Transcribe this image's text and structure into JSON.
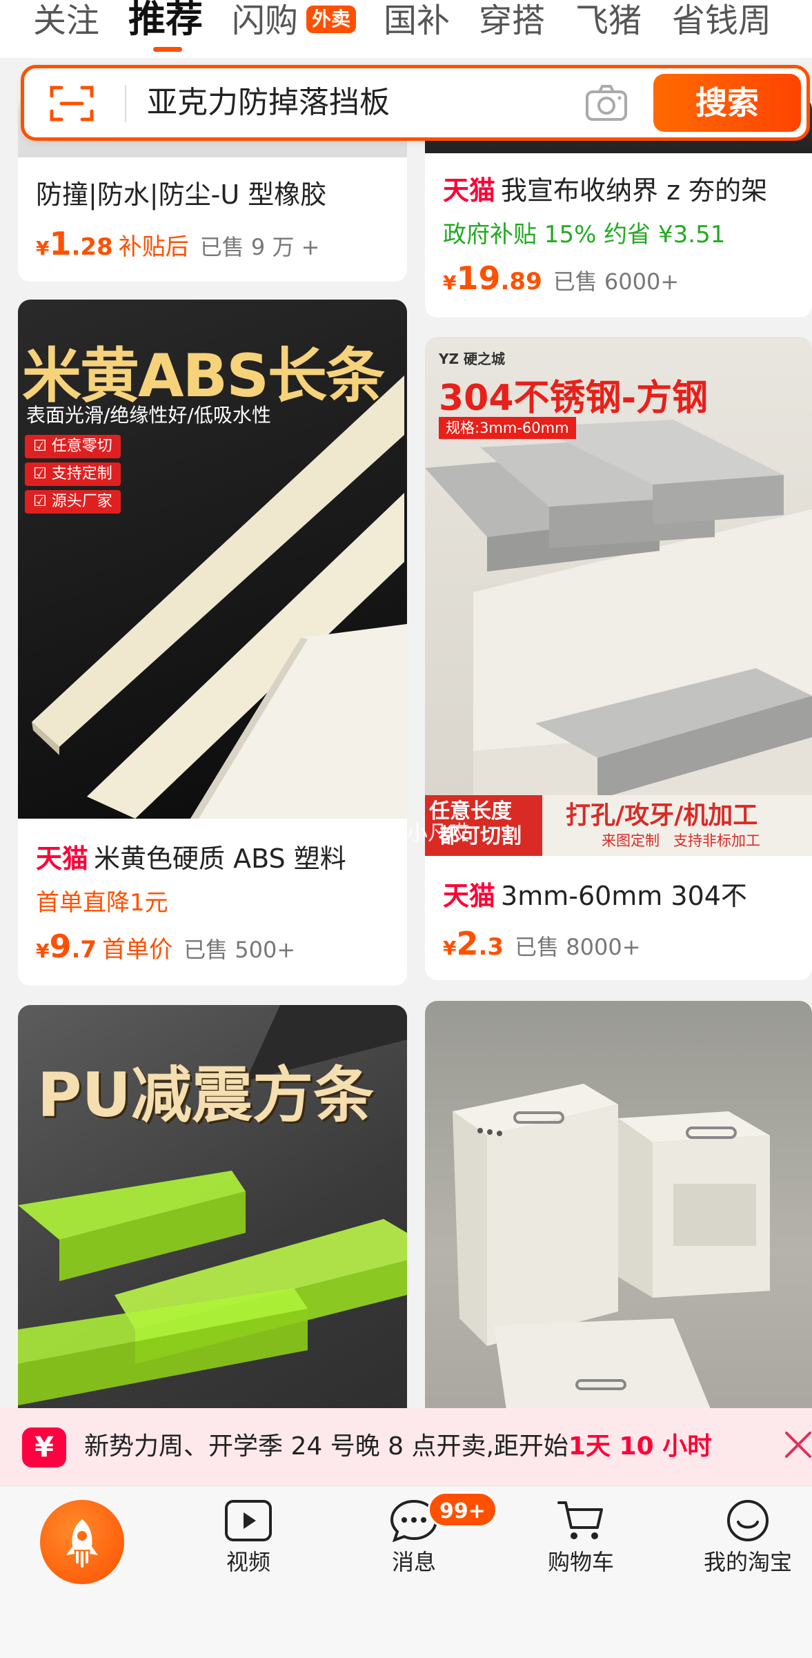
{
  "top_tabs": [
    {
      "label": "关注"
    },
    {
      "label": "推荐"
    },
    {
      "label": "闪购",
      "badge": "外卖"
    },
    {
      "label": "国补"
    },
    {
      "label": "穿搭"
    },
    {
      "label": "飞猪"
    },
    {
      "label": "省钱周"
    }
  ],
  "search": {
    "query": "亚克力防掉落挡板",
    "button_label": "搜索",
    "icons": [
      "scan-icon",
      "camera-icon"
    ]
  },
  "products": {
    "p1": {
      "title": "防撞|防水|防尘-U 型橡胶",
      "price_symbol": "¥",
      "price_int": "1",
      "price_dec": ".28",
      "price_label": "补贴后",
      "sold": "已售 9 万 +"
    },
    "p2": {
      "tag": "天猫",
      "title": "我宣布收纳界 z 夯的架",
      "promo": "政府补贴 15% 约省 ¥3.51",
      "price_symbol": "¥",
      "price_int": "19",
      "price_dec": ".89",
      "sold": "已售 6000+"
    },
    "p3": {
      "image_text": {
        "headline": "米黄ABS长条",
        "sub": "表面光滑/绝缘性好/低吸水性",
        "points": [
          "任意零切",
          "支持定制",
          "源头厂家"
        ]
      },
      "tag": "天猫",
      "title": "米黄色硬质 ABS 塑料",
      "promo": "首单直降1元",
      "price_symbol": "¥",
      "price_int": "9",
      "price_dec": ".7",
      "price_label": "首单价",
      "sold": "已售 500+"
    },
    "p4": {
      "image_text": {
        "brand": "硬之城",
        "headline": "304不锈钢-方钢",
        "spec": "规格:3mm-60mm",
        "footer_left_1": "任意长度",
        "footer_left_2": "都可切割",
        "footer_right": "打孔/攻牙/机加工",
        "footer_right_sub": "来图定制   支持非标加工"
      },
      "tag": "天猫",
      "title": "3mm-60mm 304不",
      "price_symbol": "¥",
      "price_int": "2",
      "price_dec": ".3",
      "sold": "已售 8000+"
    },
    "p5": {
      "image_text": {
        "headline": "PU减震方条"
      }
    },
    "p6": {}
  },
  "watermark": "@是先生的小凡哎",
  "banner": {
    "icon": "¥",
    "message": "新势力周、开学季 24 号晚 8 点开卖,距开始",
    "countdown": "1天 10 小时"
  },
  "bottom_nav": {
    "items": [
      {
        "label": "视频",
        "icon": "video-icon"
      },
      {
        "label": "消息",
        "icon": "message-icon",
        "badge": "99+"
      },
      {
        "label": "购物车",
        "icon": "cart-icon"
      },
      {
        "label": "我的淘宝",
        "icon": "profile-icon"
      }
    ]
  },
  "colors": {
    "accent": "#ff5000",
    "tmall_red": "#ff0036",
    "subsidy_green": "#22aa22",
    "banner_bg": "#fde9ec"
  }
}
